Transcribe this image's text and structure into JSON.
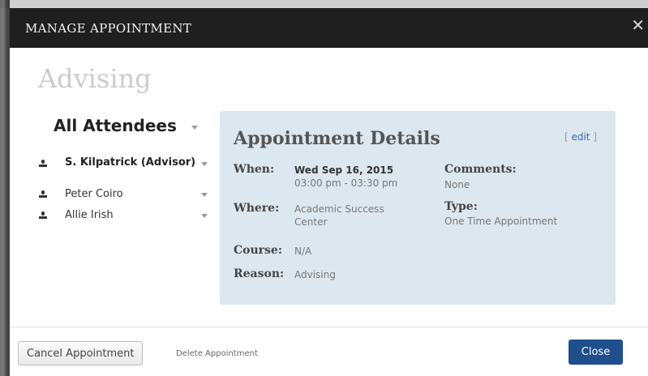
{
  "header": {
    "title": "MANAGE APPOINTMENT",
    "close_glyph": "✕"
  },
  "page_title": "Advising",
  "attendees": {
    "heading": "All Attendees",
    "items": [
      {
        "name": "S. Kilpatrick (Advisor)",
        "bold": true,
        "icon": "person-icon"
      },
      {
        "name": "Peter Coiro",
        "bold": false,
        "icon": "person-icon"
      },
      {
        "name": "Allie Irish",
        "bold": false,
        "icon": "person-icon"
      }
    ]
  },
  "details": {
    "title": "Appointment Details",
    "edit_open": "[ ",
    "edit_label": "edit",
    "edit_close": " ]",
    "when_label": "When:",
    "when_date": "Wed Sep 16, 2015",
    "when_time": "03:00 pm - 03:30 pm",
    "where_label": "Where:",
    "where_line1": "Academic Success",
    "where_line2": "Center",
    "course_label": "Course:",
    "course_value": "N/A",
    "reason_label": "Reason:",
    "reason_value": "Advising",
    "comments_label": "Comments:",
    "comments_value": "None",
    "type_label": "Type:",
    "type_value": "One Time Appointment"
  },
  "footer": {
    "cancel_label": "Cancel Appointment",
    "delete_label": "Delete Appointment",
    "close_label": "Close"
  },
  "colors": {
    "header_bg": "#1f1f1f",
    "details_bg": "#dde7f0",
    "primary_button": "#1e4f8c",
    "link": "#2a6cb5"
  }
}
